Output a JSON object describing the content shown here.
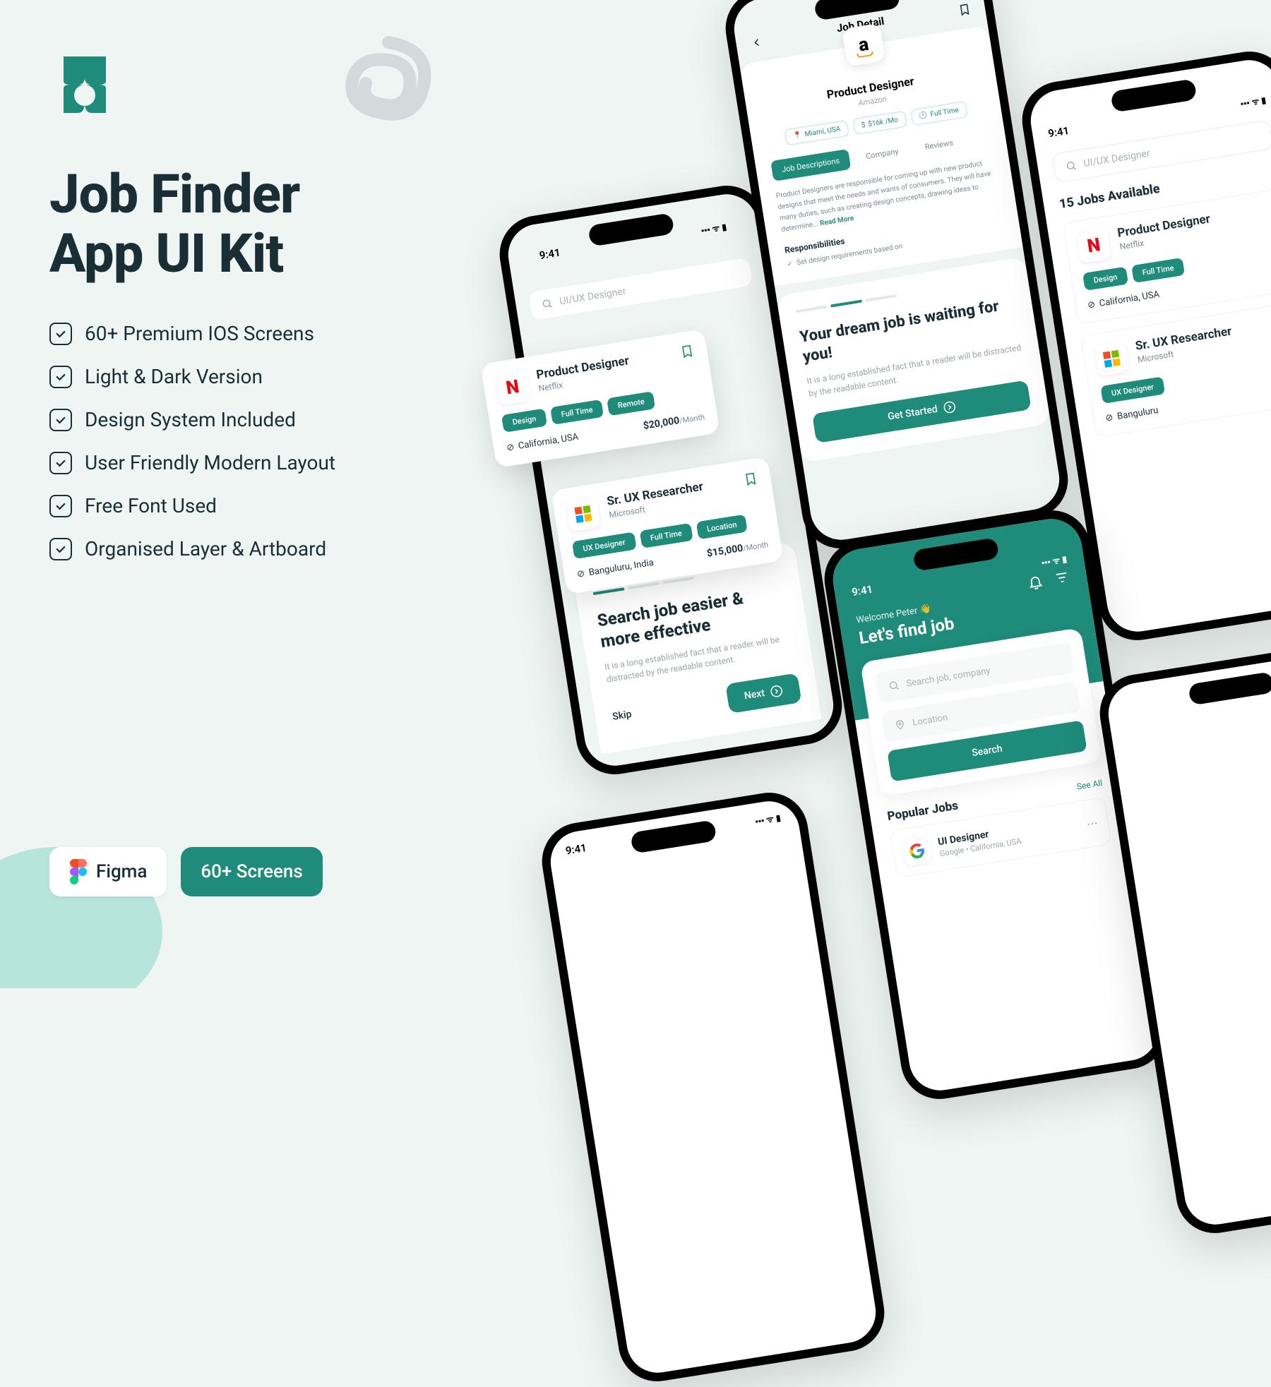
{
  "colors": {
    "primary": "#1f8b7a",
    "bg": "#eef5f3",
    "dark": "#1a2e35"
  },
  "title": "Job Finder\nApp UI Kit",
  "features": [
    "60+ Premium IOS Screens",
    "Light & Dark Version",
    "Design System Included",
    "User Friendly Modern Layout",
    "Free Font Used",
    "Organised Layer & Artboard"
  ],
  "badges": {
    "figma": "Figma",
    "screens": "60+ Screens"
  },
  "status_time": "9:41",
  "phone1": {
    "search_placeholder": "UI/UX Designer",
    "onboard_title": "Search job easier & more effective",
    "onboard_sub": "It is a long established fact that a reader will be distracted by the readable content.",
    "skip": "Skip",
    "next": "Next"
  },
  "phone2": {
    "header": "Job Detail",
    "job_title": "Product Designer",
    "company": "Amazon",
    "meta": [
      "Miami, USA",
      "$16k /Mo",
      "Full Time"
    ],
    "tabs": [
      "Job Descriptions",
      "Company",
      "Reviews"
    ],
    "desc": "Product Designers are responsible for coming up with new product designs that meet the needs and wants of consumers. They will have many duties, such as creating design concepts, drawing ideas to determine...",
    "readmore": "Read More",
    "resp_head": "Responsibilities",
    "resp_item": "Set design requirements based on",
    "onboard_title": "Your dream job is waiting for you!",
    "onboard_sub": "It is a long established fact that a reader will be distracted by the readable content.",
    "cta": "Get Started"
  },
  "phone3": {
    "search_placeholder": "UI/UX Designer",
    "results_count": "15 Jobs Available",
    "cards": [
      {
        "title": "Product Designer",
        "company": "Netflix",
        "pills": [
          "Design",
          "Full Time"
        ],
        "loc": "California, USA"
      },
      {
        "title": "Sr. UX Researcher",
        "company": "Microsoft",
        "pills": [
          "UX Designer"
        ],
        "loc": "Banguluru"
      }
    ]
  },
  "phone4": {
    "welcome": "Welcome Peter 👋",
    "headline": "Let's find job",
    "search_ph": "Search job, company",
    "location_ph": "Location",
    "search_btn": "Search",
    "section": "Popular Jobs",
    "seeall": "See All",
    "job": {
      "title": "UI Designer",
      "sub": "Google  •  California, USA"
    }
  },
  "card1": {
    "title": "Product Designer",
    "company": "Netflix",
    "pills": [
      "Design",
      "Full Time",
      "Remote"
    ],
    "loc": "California, USA",
    "salary": "$20,000",
    "period": "/Month"
  },
  "card2": {
    "title": "Sr. UX Researcher",
    "company": "Microsoft",
    "pills": [
      "UX Designer",
      "Full Time",
      "Location"
    ],
    "loc": "Banguluru, India",
    "salary": "$15,000",
    "period": "/Month"
  }
}
